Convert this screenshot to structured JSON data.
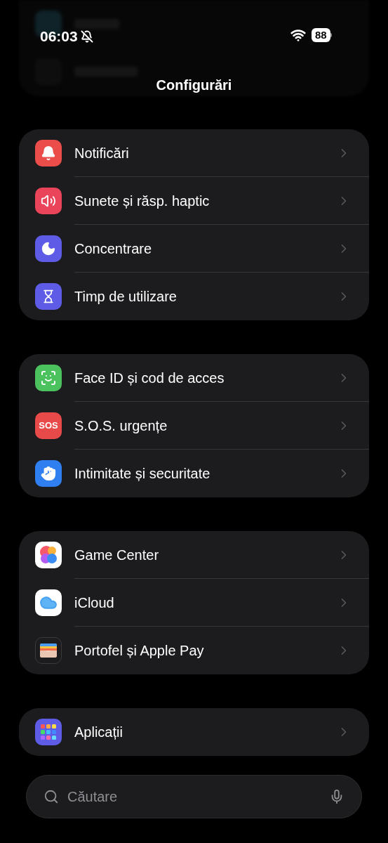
{
  "status_bar": {
    "time": "06:03",
    "battery": "88"
  },
  "title": "Configurări",
  "groups": [
    [
      {
        "kind": "notifications",
        "label": "Notificări"
      },
      {
        "kind": "sounds",
        "label": "Sunete și răsp. haptic"
      },
      {
        "kind": "focus",
        "label": "Concentrare"
      },
      {
        "kind": "screentime",
        "label": "Timp de utilizare"
      }
    ],
    [
      {
        "kind": "faceid",
        "label": "Face ID și cod de acces"
      },
      {
        "kind": "sos",
        "label": "S.O.S. urgențe",
        "icon_text": "SOS"
      },
      {
        "kind": "privacy",
        "label": "Intimitate și securitate"
      }
    ],
    [
      {
        "kind": "gamecenter",
        "label": "Game Center"
      },
      {
        "kind": "icloud",
        "label": "iCloud"
      },
      {
        "kind": "wallet",
        "label": "Portofel și Apple Pay"
      }
    ],
    [
      {
        "kind": "apps",
        "label": "Aplicații"
      }
    ]
  ],
  "search": {
    "placeholder": "Căutare"
  }
}
